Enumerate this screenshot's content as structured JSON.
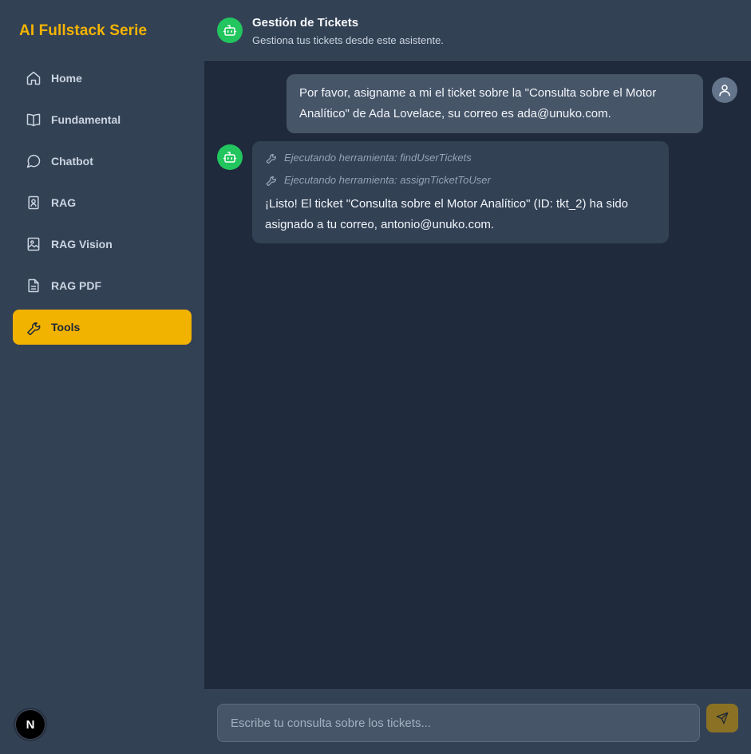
{
  "sidebar": {
    "brand": "AI Fullstack Serie",
    "items": [
      {
        "label": "Home",
        "icon": "home-icon"
      },
      {
        "label": "Fundamental",
        "icon": "book-icon"
      },
      {
        "label": "Chatbot",
        "icon": "chat-bubble-icon"
      },
      {
        "label": "RAG",
        "icon": "contact-book-icon"
      },
      {
        "label": "RAG Vision",
        "icon": "image-icon"
      },
      {
        "label": "RAG PDF",
        "icon": "document-icon"
      },
      {
        "label": "Tools",
        "icon": "wrench-icon",
        "active": true
      }
    ],
    "badge": "N"
  },
  "header": {
    "title": "Gestión de Tickets",
    "subtitle": "Gestiona tus tickets desde este asistente."
  },
  "chat": {
    "messages": [
      {
        "role": "user",
        "text": "Por favor, asigname a mi el ticket sobre la \"Consulta sobre el Motor Analítico\" de Ada Lovelace, su correo es ada@unuko.com."
      },
      {
        "role": "assistant",
        "tools": [
          "Ejecutando herramienta: findUserTickets",
          "Ejecutando herramienta: assignTicketToUser"
        ],
        "text": "¡Listo! El ticket \"Consulta sobre el Motor Analítico\" (ID: tkt_2) ha sido asignado a tu correo, antonio@unuko.com."
      }
    ]
  },
  "composer": {
    "placeholder": "Escribe tu consulta sobre los tickets...",
    "value": ""
  },
  "colors": {
    "accent": "#f2b200",
    "bot": "#22c55e",
    "sidebar": "#334155",
    "background": "#1f2a3c"
  }
}
